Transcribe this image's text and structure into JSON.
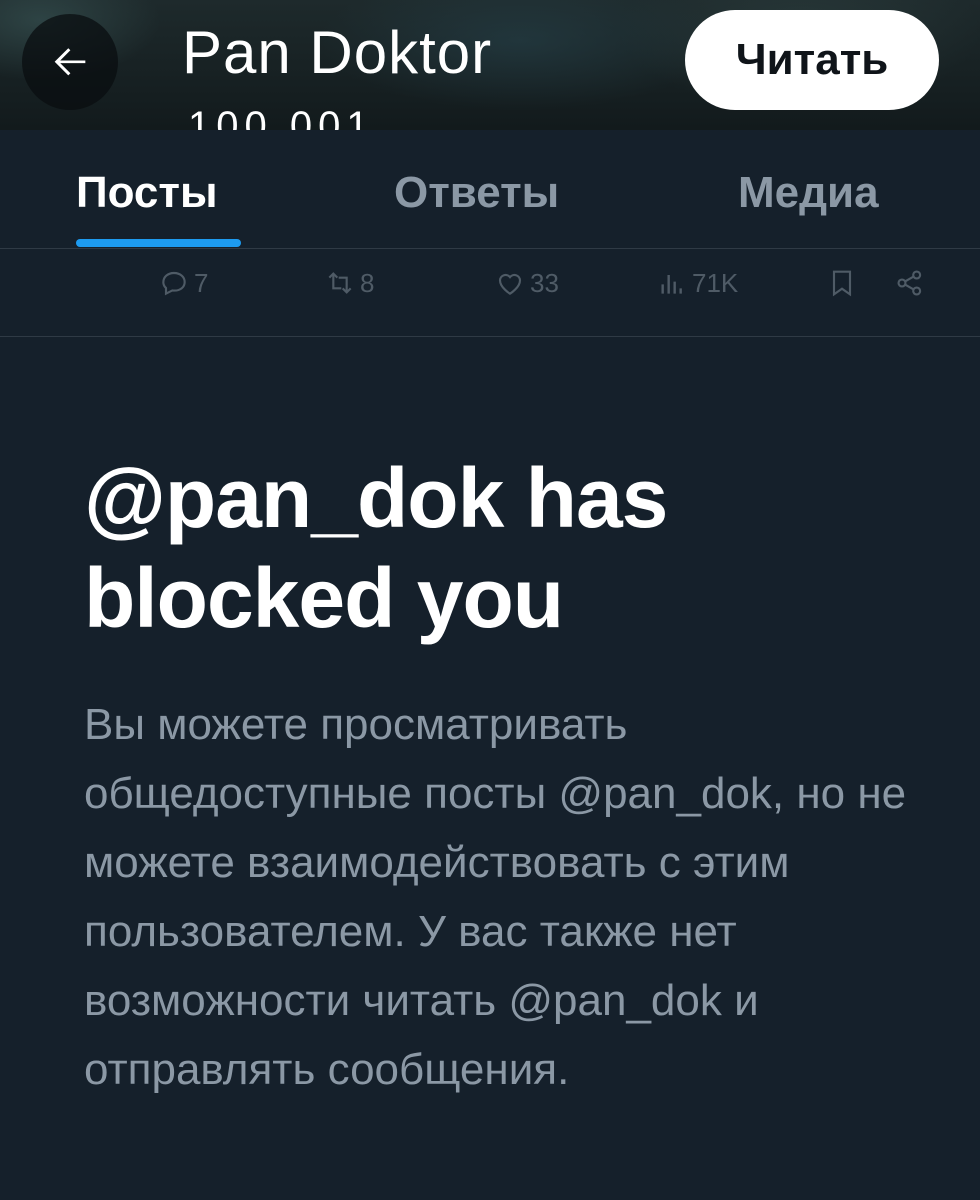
{
  "header": {
    "back_icon": "arrow-left-icon",
    "profile_name": "Pan Doktor",
    "post_count_partial": "100 001",
    "follow_label": "Читать"
  },
  "tabs": [
    {
      "label": "Посты",
      "active": true
    },
    {
      "label": "Ответы",
      "active": false
    },
    {
      "label": "Медиа",
      "active": false
    }
  ],
  "post_actions": {
    "replies": "7",
    "reposts": "8",
    "likes": "33",
    "views": "71K"
  },
  "blocked": {
    "title": "@pan_dok has blocked you",
    "body": "Вы можете просматривать общедоступные посты @pan_dok, но не можете взаимодействовать с этим пользователем. У вас также нет возможности читать @pan_dok и отправлять сообщения."
  },
  "colors": {
    "background": "#15202b",
    "accent": "#1d9bf0",
    "muted_text": "#8b98a5",
    "divider": "#2f3a45"
  }
}
